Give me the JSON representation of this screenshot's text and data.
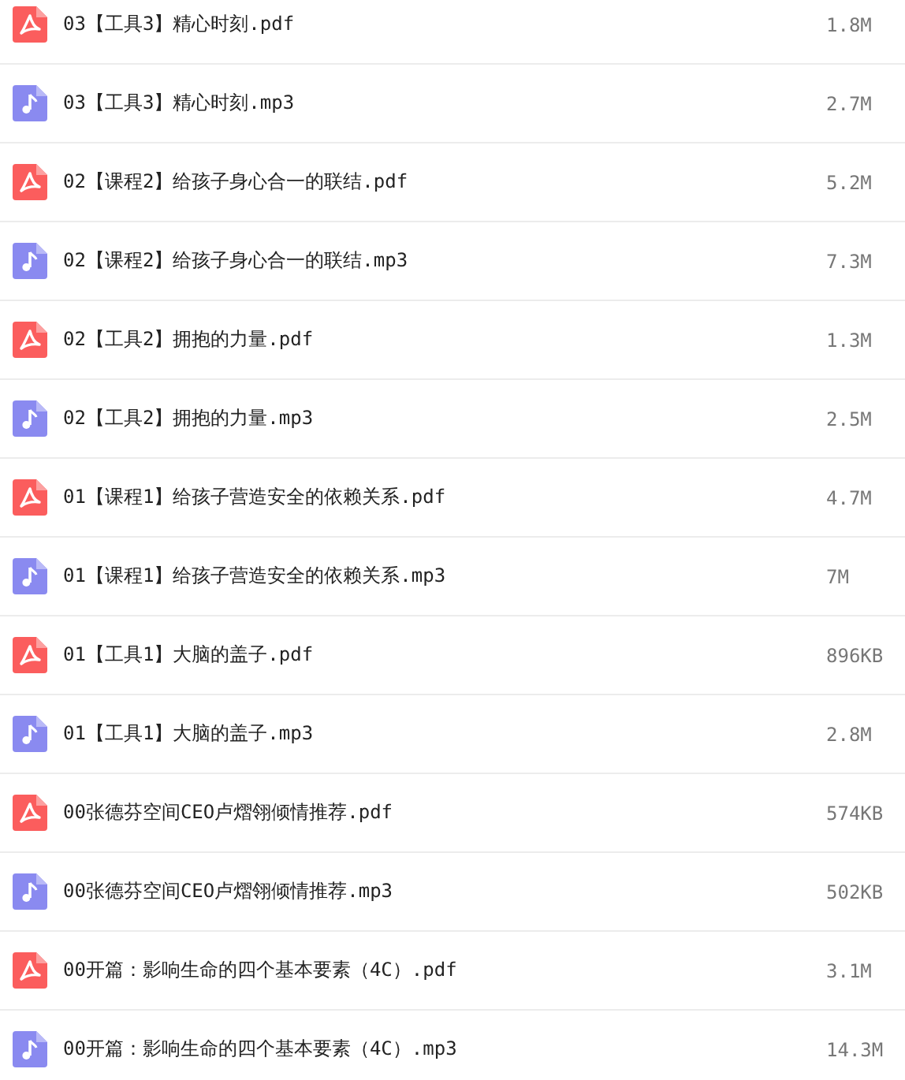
{
  "files": [
    {
      "kind": "pdf",
      "name": "03【工具3】精心时刻.pdf",
      "size": "1.8M"
    },
    {
      "kind": "audio",
      "name": "03【工具3】精心时刻.mp3",
      "size": "2.7M"
    },
    {
      "kind": "pdf",
      "name": "02【课程2】给孩子身心合一的联结.pdf",
      "size": "5.2M"
    },
    {
      "kind": "audio",
      "name": "02【课程2】给孩子身心合一的联结.mp3",
      "size": "7.3M"
    },
    {
      "kind": "pdf",
      "name": "02【工具2】拥抱的力量.pdf",
      "size": "1.3M"
    },
    {
      "kind": "audio",
      "name": "02【工具2】拥抱的力量.mp3",
      "size": "2.5M"
    },
    {
      "kind": "pdf",
      "name": "01【课程1】给孩子营造安全的依赖关系.pdf",
      "size": "4.7M"
    },
    {
      "kind": "audio",
      "name": "01【课程1】给孩子营造安全的依赖关系.mp3",
      "size": "7M"
    },
    {
      "kind": "pdf",
      "name": "01【工具1】大脑的盖子.pdf",
      "size": "896KB"
    },
    {
      "kind": "audio",
      "name": "01【工具1】大脑的盖子.mp3",
      "size": "2.8M"
    },
    {
      "kind": "pdf",
      "name": "00张德芬空间CEO卢熠翎倾情推荐.pdf",
      "size": "574KB"
    },
    {
      "kind": "audio",
      "name": "00张德芬空间CEO卢熠翎倾情推荐.mp3",
      "size": "502KB"
    },
    {
      "kind": "pdf",
      "name": "00开篇：影响生命的四个基本要素（4C）.pdf",
      "size": "3.1M"
    },
    {
      "kind": "audio",
      "name": "00开篇：影响生命的四个基本要素（4C）.mp3",
      "size": "14.3M"
    }
  ]
}
